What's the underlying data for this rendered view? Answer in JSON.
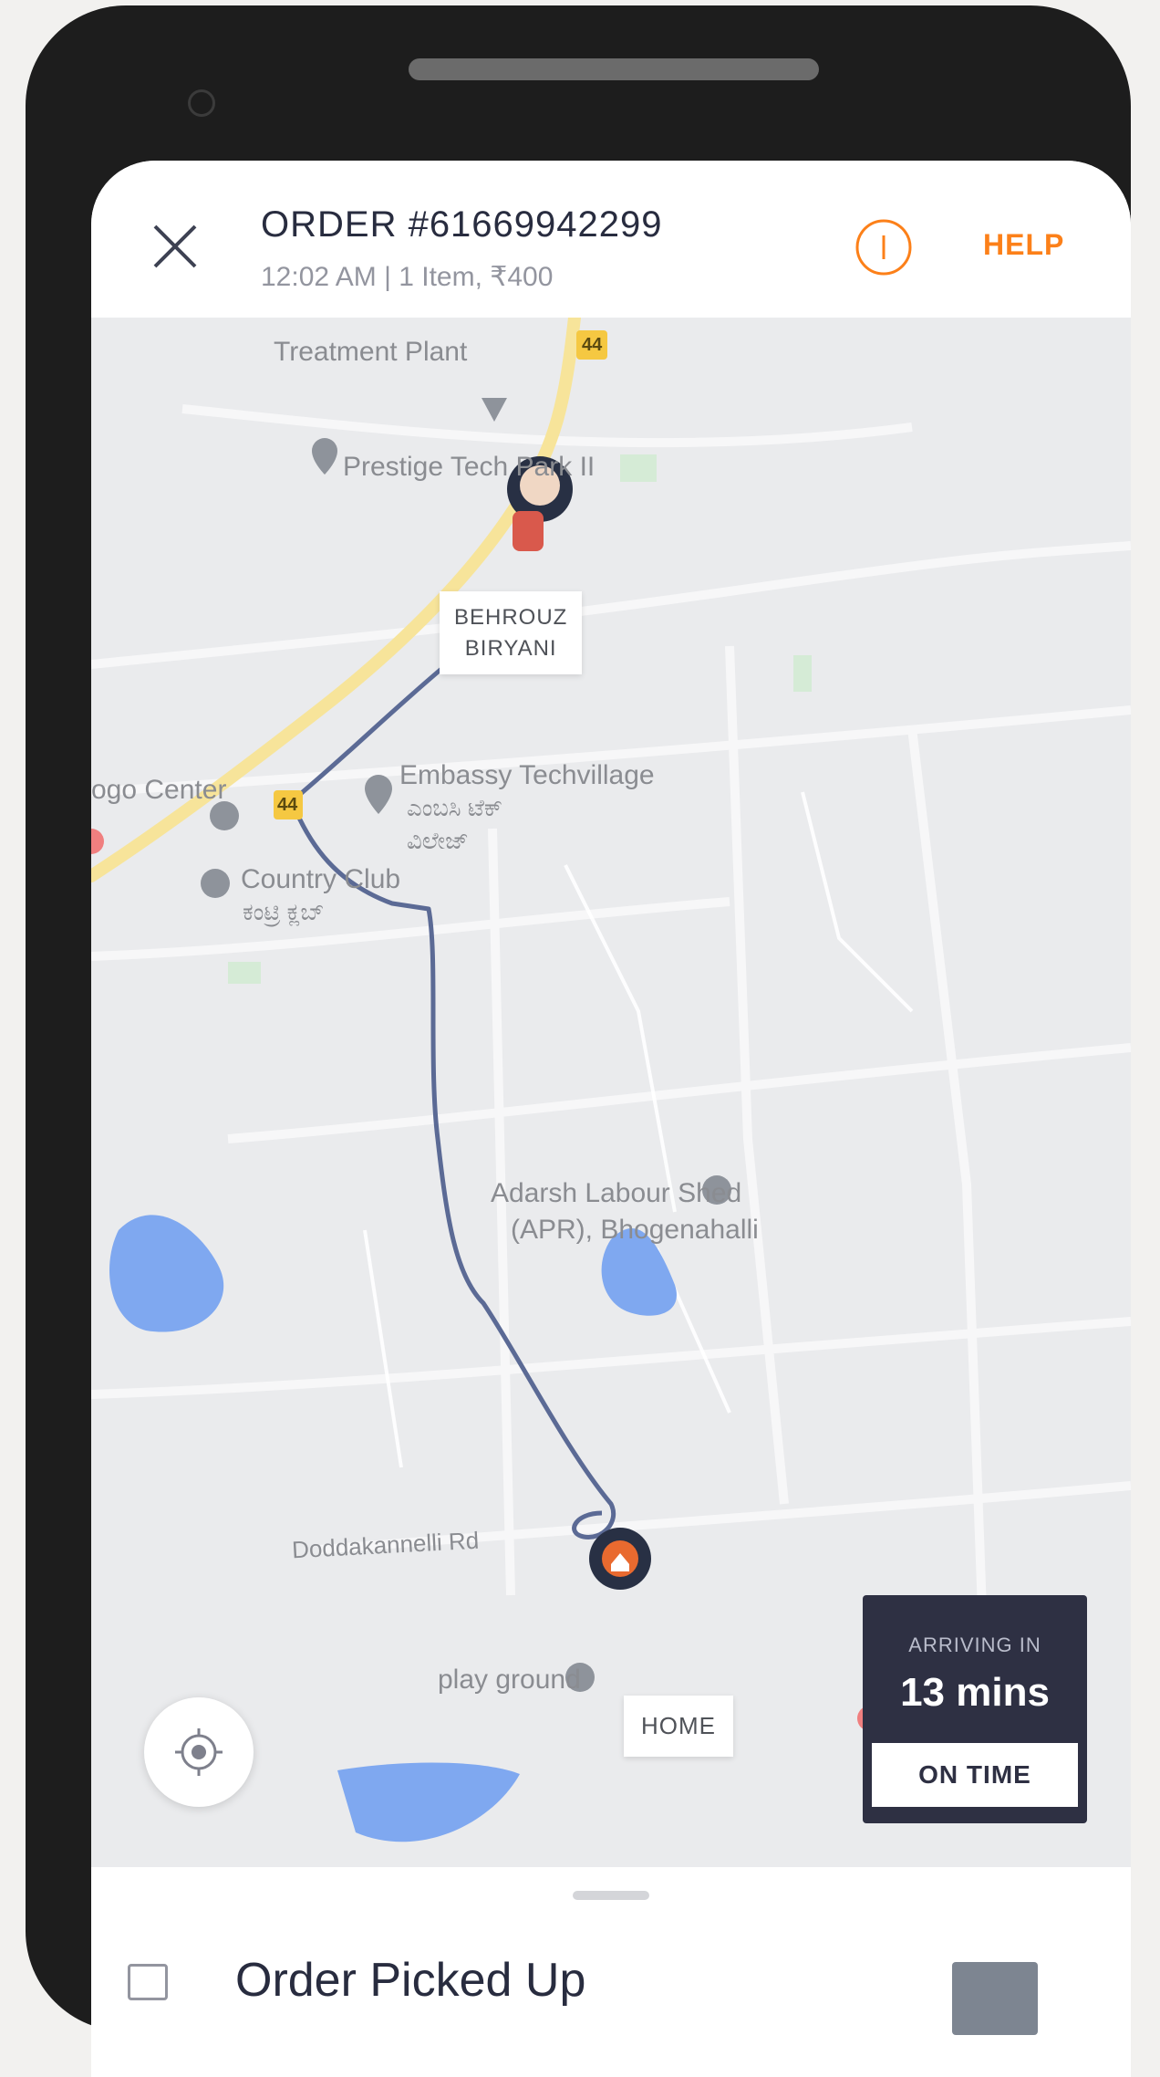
{
  "header": {
    "order_title": "ORDER #61669942299",
    "order_subtitle": "12:02 AM | 1 Item, ₹400",
    "help_label": "HELP"
  },
  "map": {
    "places": {
      "treatment_plant": "Treatment Plant",
      "prestige": "Prestige Tech Park II",
      "logo_center": "ogo Center",
      "embassy": "Embassy Techvillage",
      "embassy_local": "ಎಂಬಸಿ ಟೆಕ್",
      "embassy_local2": "ವಿಲೇಜ್",
      "country_club": "Country Club",
      "country_club_local": "ಕಂಟ್ರಿ ಕ್ಲಬ್",
      "adarsh": "Adarsh Labour Shed",
      "adarsh2": "(APR), Bhogenahalli",
      "road": "Doddakannelli Rd",
      "ground": "play ground"
    },
    "highway_badge": "44",
    "restaurant_label_line1": "BEHROUZ",
    "restaurant_label_line2": "BIRYANI",
    "home_label": "HOME"
  },
  "eta": {
    "caption": "ARRIVING IN",
    "value": "13 mins",
    "status": "ON TIME"
  },
  "sheet": {
    "status_title": "Order Picked Up"
  },
  "colors": {
    "accent": "#fc8019",
    "route": "#5b6a95",
    "highway": "#f7e49a",
    "water": "#7fa8f0",
    "eta_card": "#2e3043"
  }
}
